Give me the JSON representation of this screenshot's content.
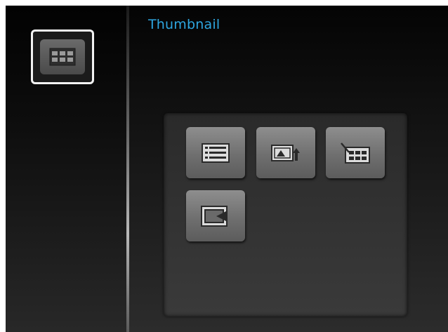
{
  "header": {
    "title": "Thumbnail"
  },
  "sidebar": {
    "selected_icon": "thumbnail-grid-icon"
  },
  "panel": {
    "options": [
      {
        "icon": "list-view-icon"
      },
      {
        "icon": "image-export-icon"
      },
      {
        "icon": "thumbnail-edit-icon"
      },
      {
        "icon": "slideshow-icon"
      }
    ]
  },
  "colors": {
    "title": "#2ea6e0",
    "selection_border": "#f2f2f2",
    "tile": "#7a7a7a"
  }
}
